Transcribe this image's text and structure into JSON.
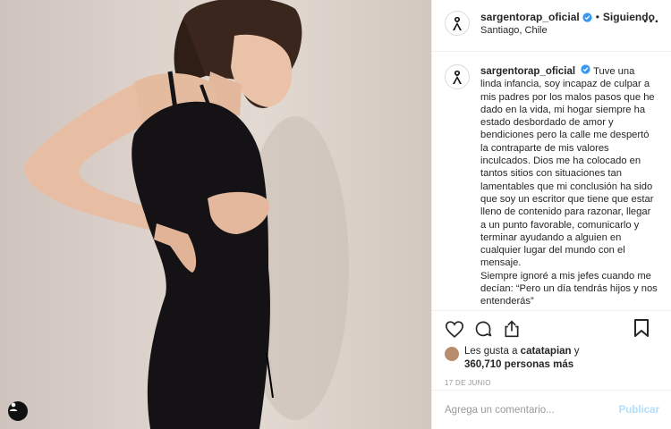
{
  "post": {
    "image_alt": "Mujer embarazada con vestido negro",
    "user_tag_icon": "user-tag-icon"
  },
  "header": {
    "username": "sargentorap_oficial",
    "separator": "•",
    "follow_label": "Siguiendo",
    "location": "Santiago, Chile",
    "more_icon": "more-options-icon",
    "avatar_icon": "black-ribbon-icon"
  },
  "caption": {
    "username": "sargentorap_oficial",
    "text": "Tuve una linda infancia, soy incapaz de culpar a mis padres por los malos pasos que he dado en la vida, mi hogar siempre ha estado desbordado de amor y bendiciones pero la calle me despertó la contraparte de mis valores inculcados. Dios me ha colocado en tantos sitios con situaciones tan lamentables que mi conclusión ha sido que soy un escritor que tiene que estar lleno de contenido para razonar, llegar a un punto favorable, comunicarlo y terminar ayudando a alguien en cualquier lugar del mundo con el mensaje.\nSiempre ignoré a mis jefes cuando me decían: “Pero un día tendrás hijos y nos entenderás”"
  },
  "actions": {
    "like_icon": "heart-icon",
    "comment_icon": "comment-icon",
    "share_icon": "share-icon",
    "save_icon": "bookmark-icon"
  },
  "likes": {
    "prefix": "Les gusta a",
    "user": "catatapian",
    "connector": "y",
    "count": "360,710",
    "suffix": "personas más"
  },
  "date": "17 DE JUNIO",
  "comment": {
    "placeholder": "Agrega un comentario...",
    "publish_label": "Publicar"
  },
  "colors": {
    "verified": "#3897f0",
    "publish_disabled": "#b2dffc",
    "dress": "#141214"
  }
}
